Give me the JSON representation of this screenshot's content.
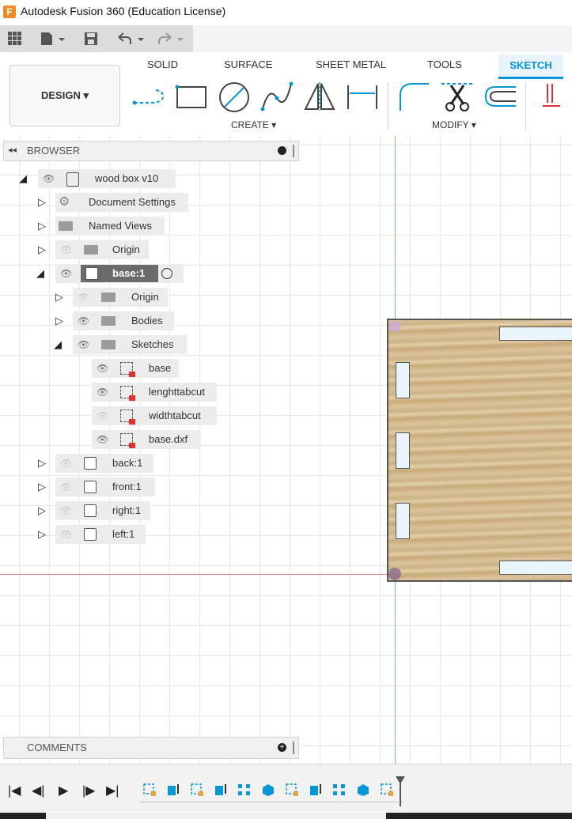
{
  "window": {
    "title": "Autodesk Fusion 360 (Education License)",
    "logo": "F"
  },
  "quick_access": {
    "icons": [
      "apps-grid-icon",
      "file-icon",
      "save-icon",
      "undo-icon",
      "redo-icon"
    ]
  },
  "ribbon": {
    "workspace_label": "DESIGN ▾",
    "tabs": [
      "SOLID",
      "SURFACE",
      "SHEET METAL",
      "TOOLS",
      "SKETCH"
    ],
    "active_tab": "SKETCH",
    "groups": {
      "create": "CREATE ▾",
      "modify": "MODIFY ▾"
    },
    "accent_color": "#0696d7"
  },
  "browser": {
    "title": "BROWSER",
    "root": "wood box v10",
    "items": {
      "document_settings": "Document Settings",
      "named_views": "Named Views",
      "origin": "Origin",
      "base": "base:1",
      "base_origin": "Origin",
      "bodies": "Bodies",
      "sketches": "Sketches",
      "sketch_base": "base",
      "sketch_length": "lenghttabcut",
      "sketch_width": "widthtabcut",
      "sketch_dxf": "base.dxf",
      "back": "back:1",
      "front": "front:1",
      "right": "right:1",
      "left": "left:1"
    }
  },
  "comments": {
    "title": "COMMENTS"
  }
}
